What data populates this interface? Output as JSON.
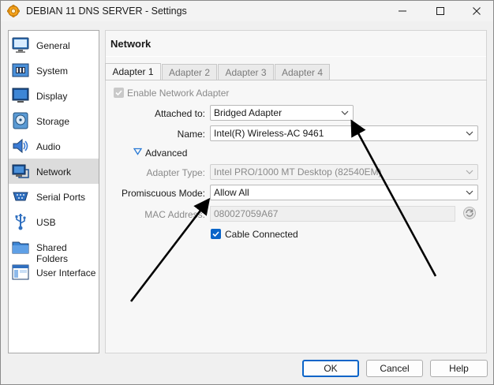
{
  "window": {
    "title": "DEBIAN 11 DNS SERVER - Settings",
    "controls": {
      "minimize": "—",
      "maximize": "☐",
      "close": "✕"
    }
  },
  "sidebar": {
    "items": [
      {
        "label": "General",
        "icon": "monitor-icon"
      },
      {
        "label": "System",
        "icon": "chip-icon"
      },
      {
        "label": "Display",
        "icon": "display-icon"
      },
      {
        "label": "Storage",
        "icon": "disk-icon"
      },
      {
        "label": "Audio",
        "icon": "speaker-icon"
      },
      {
        "label": "Network",
        "icon": "network-icon",
        "active": true
      },
      {
        "label": "Serial Ports",
        "icon": "serial-icon"
      },
      {
        "label": "USB",
        "icon": "usb-icon"
      },
      {
        "label": "Shared Folders",
        "icon": "folder-icon"
      },
      {
        "label": "User Interface",
        "icon": "ui-icon"
      }
    ]
  },
  "main": {
    "title": "Network",
    "tabs": [
      "Adapter 1",
      "Adapter 2",
      "Adapter 3",
      "Adapter 4"
    ],
    "active_tab": 0,
    "enable_adapter": {
      "label": "Enable Network Adapter",
      "checked": true,
      "disabled": true
    },
    "attached_to": {
      "label": "Attached to:",
      "value": "Bridged Adapter"
    },
    "name": {
      "label": "Name:",
      "value": "Intel(R) Wireless-AC 9461"
    },
    "advanced": {
      "label": "Advanced"
    },
    "adapter_type": {
      "label": "Adapter Type:",
      "value": "Intel PRO/1000 MT Desktop (82540EM)"
    },
    "promiscuous": {
      "label": "Promiscuous Mode:",
      "value": "Allow All"
    },
    "mac": {
      "label": "MAC Address:",
      "value": "080027059A67"
    },
    "cable": {
      "label": "Cable Connected",
      "checked": true
    }
  },
  "buttons": {
    "ok": "OK",
    "cancel": "Cancel",
    "help": "Help"
  },
  "colors": {
    "accent": "#0a64c8",
    "active_item": "#dcdcdc",
    "arrow": "#000000"
  }
}
